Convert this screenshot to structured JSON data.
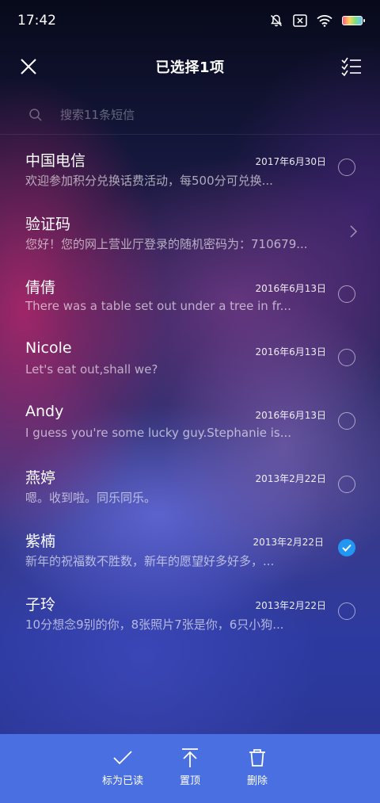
{
  "status": {
    "time": "17:42",
    "icons": [
      "mute-icon",
      "no-sim-icon",
      "wifi-icon",
      "battery-icon"
    ]
  },
  "header": {
    "title": "已选择1项",
    "close_icon": "close-icon",
    "select_all_icon": "select-all-icon"
  },
  "search": {
    "placeholder": "搜索11条短信"
  },
  "messages": [
    {
      "name": "中国电信",
      "date": "2017年6月30日",
      "preview": "欢迎参加积分兑换话费活动，每500分可兑换...",
      "selected": false
    },
    {
      "name": "验证码",
      "date": "",
      "preview": "您好！您的网上营业厅登录的随机密码为：710679...",
      "folder": true
    },
    {
      "name": "倩倩",
      "date": "2016年6月13日",
      "preview": "There was a table set out under a tree in fr...",
      "selected": false
    },
    {
      "name": "Nicole",
      "date": "2016年6月13日",
      "preview": "Let's eat out,shall we?",
      "selected": false
    },
    {
      "name": "Andy",
      "date": "2016年6月13日",
      "preview": "I guess you're some lucky guy.Stephanie is...",
      "selected": false
    },
    {
      "name": "燕婷",
      "date": "2013年2月22日",
      "preview": "嗯。收到啦。同乐同乐。",
      "selected": false
    },
    {
      "name": "紫楠",
      "date": "2013年2月22日",
      "preview": "新年的祝福数不胜数，新年的愿望好多好多，...",
      "selected": true
    },
    {
      "name": "子玲",
      "date": "2013年2月22日",
      "preview": "10分想念9别的你，8张照片7张是你，6只小狗...",
      "selected": false
    }
  ],
  "actions": {
    "mark_read": "标为已读",
    "pin_top": "置顶",
    "delete": "删除"
  },
  "colors": {
    "accent": "#2196f3",
    "bottom_bar": "#4a6fe0"
  }
}
